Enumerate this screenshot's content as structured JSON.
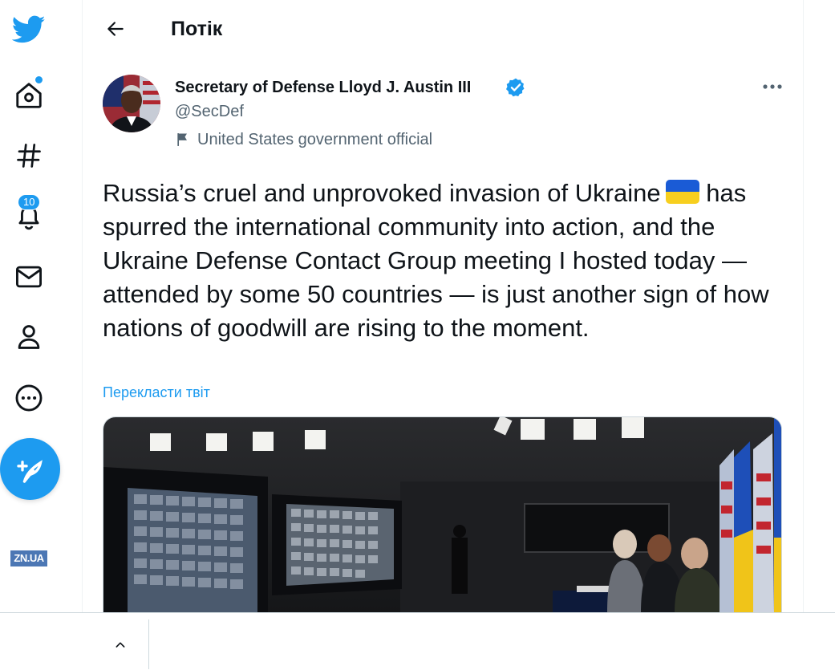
{
  "header": {
    "title": "Потік"
  },
  "nav": {
    "notifications_count": "10",
    "logo_text": "ZN.UA"
  },
  "tweet": {
    "author_name": "Secretary of Defense Lloyd J. Austin III",
    "handle": "@SecDef",
    "label": "United States government official",
    "text_before_flag": "Russia’s cruel and unprovoked invasion of Ukraine",
    "text_after_flag": "has spurred the international community into action, and the Ukraine Defense Contact Group meeting I hosted today — attended by some 50 countries — is just another sign of how nations of goodwill are rising to the moment.",
    "translate_link": "Перекласти твіт"
  },
  "colors": {
    "accent": "#1d9bf0",
    "secondary_text": "#536471",
    "flag_blue": "#1a5bd6",
    "flag_yellow": "#f7cf1f"
  },
  "icons": [
    "twitter-bird-icon",
    "home-icon",
    "hashtag-icon",
    "bell-icon",
    "envelope-icon",
    "profile-icon",
    "more-circle-icon",
    "compose-feather-icon",
    "back-arrow-icon",
    "verified-badge-icon",
    "flag-icon",
    "more-horizontal-icon",
    "chevron-up-icon"
  ]
}
